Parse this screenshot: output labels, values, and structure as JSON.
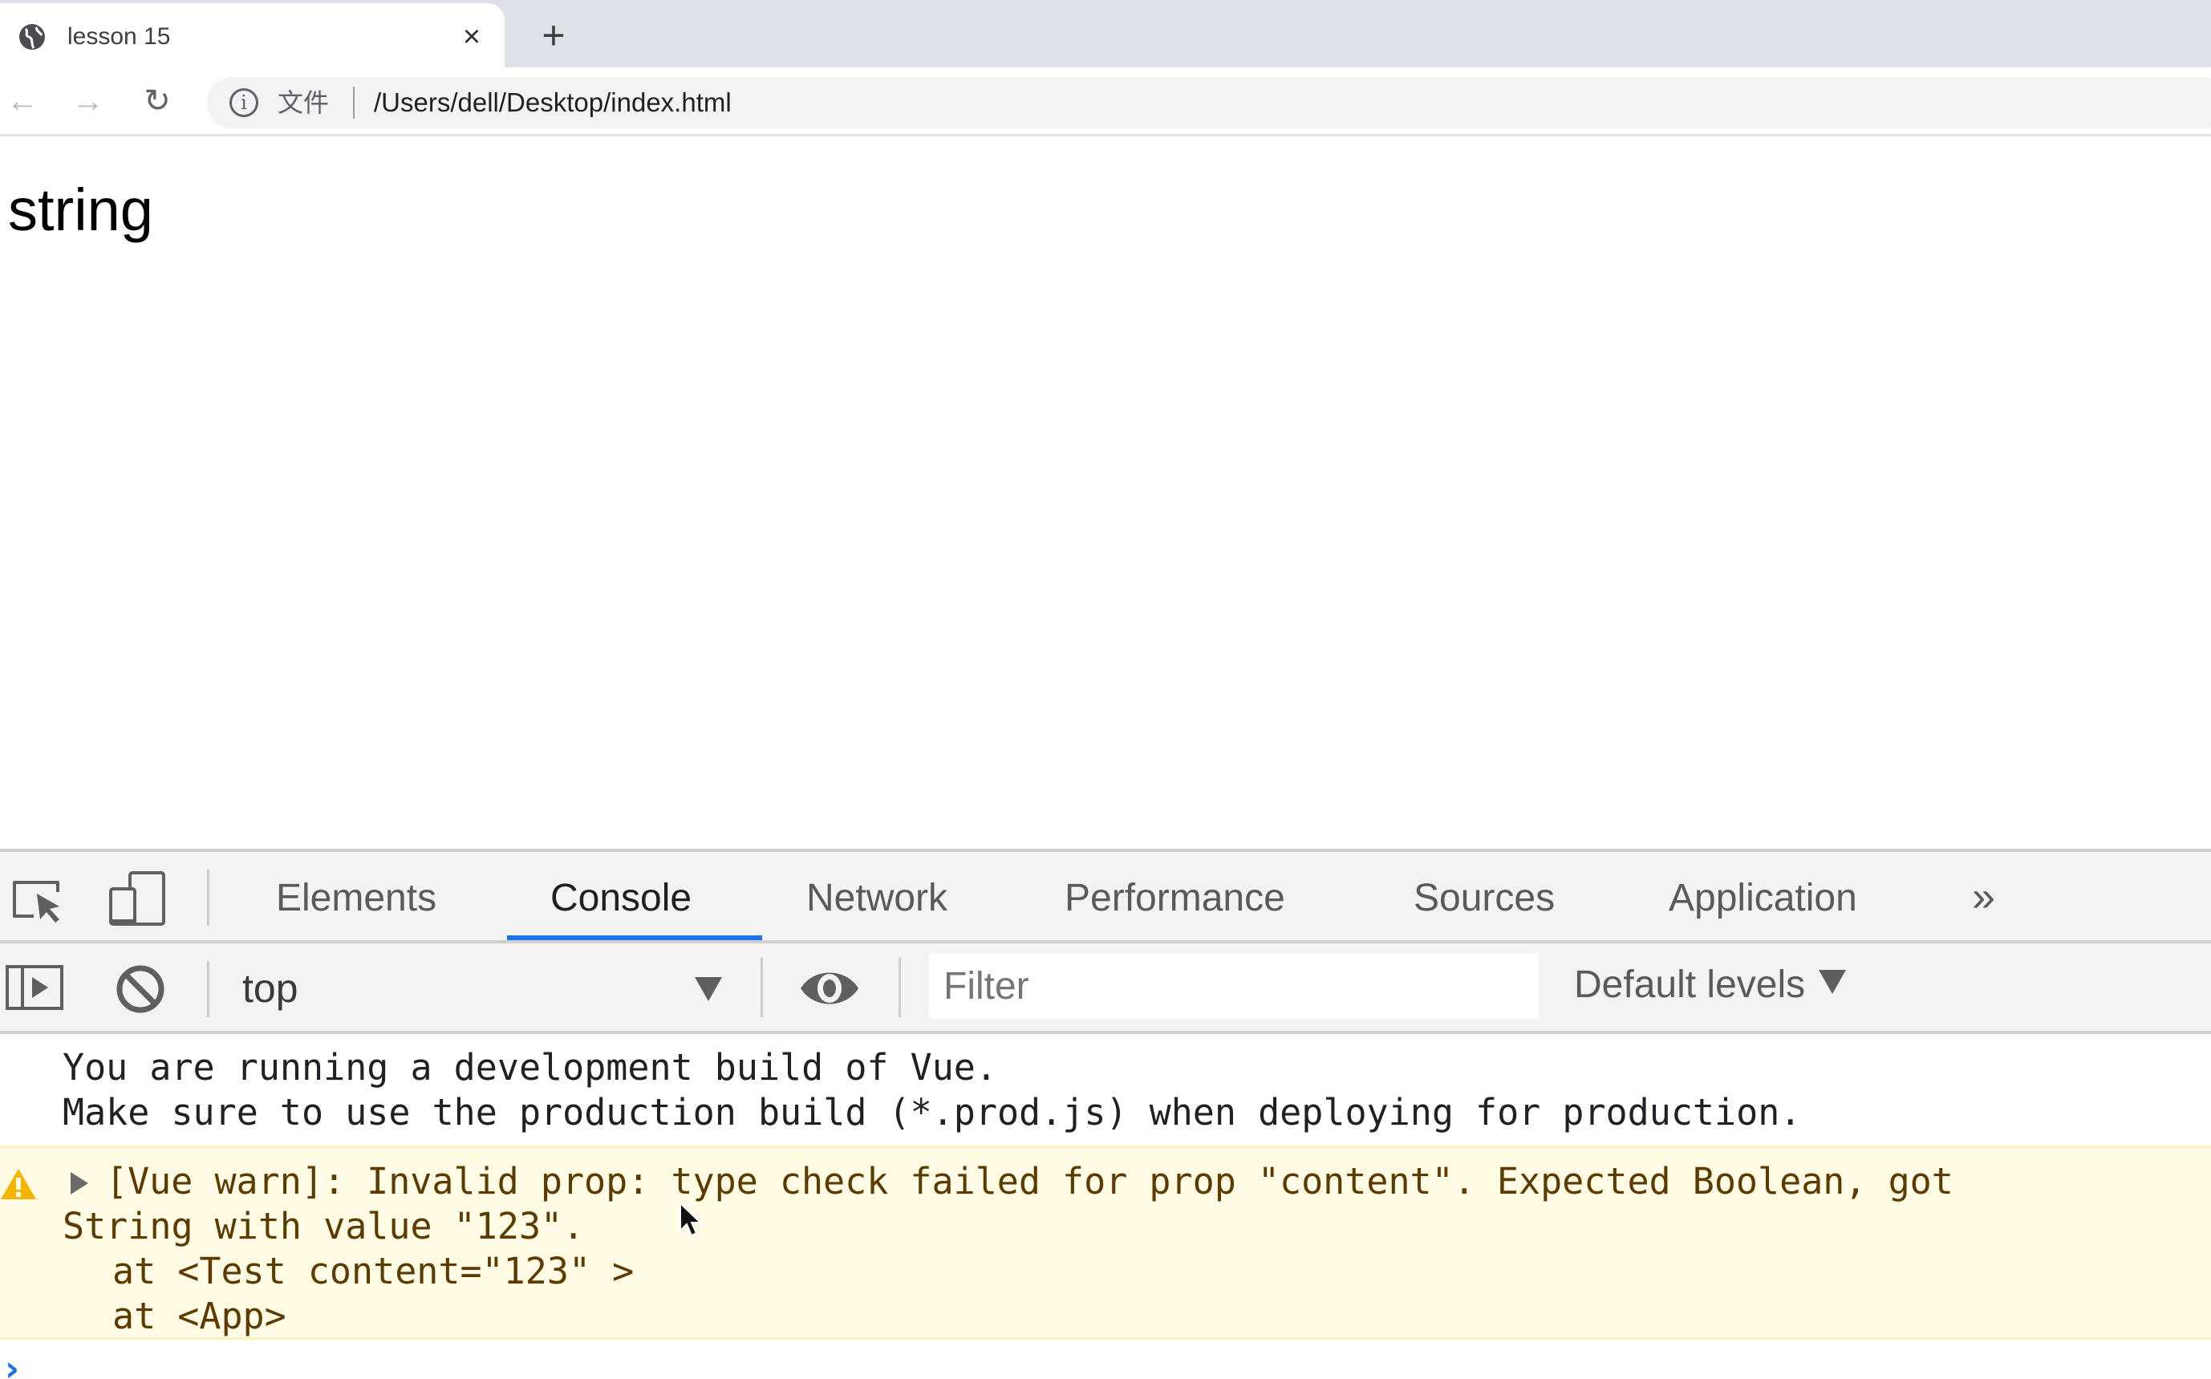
{
  "browser": {
    "tab": {
      "title": "lesson 15",
      "close_symbol": "×"
    },
    "new_tab_symbol": "+",
    "nav": {
      "back_symbol": "←",
      "forward_symbol": "→",
      "reload_symbol": "↻"
    },
    "omnibox": {
      "info_symbol": "i",
      "scheme_label": "文件",
      "url": "/Users/dell/Desktop/index.html"
    }
  },
  "page": {
    "text": "string"
  },
  "devtools": {
    "tabs": [
      {
        "label": "Elements",
        "active": false
      },
      {
        "label": "Console",
        "active": true
      },
      {
        "label": "Network",
        "active": false
      },
      {
        "label": "Performance",
        "active": false
      },
      {
        "label": "Sources",
        "active": false
      },
      {
        "label": "Application",
        "active": false
      }
    ],
    "more_tabs_symbol": "»",
    "console_toolbar": {
      "context": "top",
      "filter_placeholder": "Filter",
      "filter_value": "",
      "levels": "Default levels"
    },
    "messages": {
      "info": [
        "You are running a development build of Vue.",
        "Make sure to use the production build (*.prod.js) when deploying for production."
      ],
      "warning": {
        "line1": "[Vue warn]: Invalid prop: type check failed for prop \"content\". Expected Boolean, got",
        "line2": "String with value \"123\".",
        "trace": [
          "at <Test content=\"123\" >",
          "at <App>"
        ]
      }
    },
    "prompt_symbol": "›"
  },
  "colors": {
    "accent": "#1a73e8",
    "warning_bg": "#fffbe5",
    "warning_text": "#5c3b00",
    "warning_icon": "#f4b400"
  }
}
